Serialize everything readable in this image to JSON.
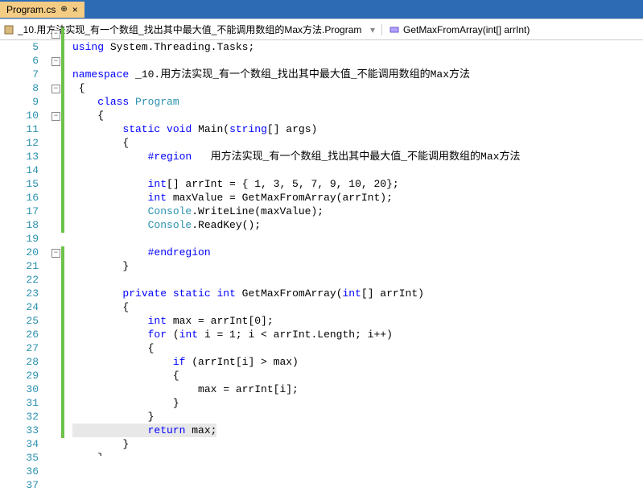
{
  "tab": {
    "title": "Program.cs",
    "pin": "⊕",
    "close": "×"
  },
  "nav": {
    "left_icon": "⚡",
    "scope": "_10.用方法实现_有一个数组_找出其中最大值_不能调用数组的Max方法.Program",
    "right_icon": "⚙",
    "method": "GetMaxFromArray(int[] arrInt)",
    "arrow": "▾"
  },
  "lines": [
    {
      "n": "5",
      "outline": "[",
      "code": [
        "kw:using",
        " System.Threading.Tasks;"
      ]
    },
    {
      "n": "6",
      "code": []
    },
    {
      "n": "7",
      "outline": "-",
      "green": 1,
      "code": [
        "kw:namespace",
        " _10.用方法实现_有一个数组_找出其中最大值_不能调用数组的Max方法"
      ]
    },
    {
      "n": "8",
      "green": 1,
      "code": [
        " {"
      ]
    },
    {
      "n": "9",
      "outline": "-",
      "green": 1,
      "code": [
        "    ",
        "kw:class",
        " ",
        "type:Program"
      ]
    },
    {
      "n": "10",
      "green": 1,
      "code": [
        "    {"
      ]
    },
    {
      "n": "11",
      "outline": "-",
      "green": 1,
      "code": [
        "        ",
        "kw:static",
        " ",
        "kw:void",
        " Main(",
        "kw:string",
        "[] args)"
      ]
    },
    {
      "n": "12",
      "green": 1,
      "code": [
        "        {"
      ]
    },
    {
      "n": "13",
      "outline": "-",
      "green": 1,
      "code": [
        "            ",
        "kw:#region",
        "   用方法实现_有一个数组_找出其中最大值_不能调用数组的Max方法"
      ]
    },
    {
      "n": "14",
      "green": 1,
      "code": []
    },
    {
      "n": "15",
      "green": 1,
      "code": [
        "            ",
        "kw:int",
        "[] arrInt = { 1, 3, 5, 7, 9, 10, 20};"
      ]
    },
    {
      "n": "16",
      "green": 1,
      "code": [
        "            ",
        "kw:int",
        " maxValue = GetMaxFromArray(arrInt);"
      ]
    },
    {
      "n": "17",
      "green": 1,
      "code": [
        "            ",
        "type:Console",
        ".WriteLine(maxValue);"
      ]
    },
    {
      "n": "18",
      "green": 1,
      "code": [
        "            ",
        "type:Console",
        ".ReadKey();"
      ]
    },
    {
      "n": "19",
      "green": 1,
      "code": []
    },
    {
      "n": "20",
      "green": 1,
      "code": [
        "            ",
        "kw:#endregion"
      ]
    },
    {
      "n": "21",
      "green": 1,
      "code": [
        "        }"
      ]
    },
    {
      "n": "22",
      "code": []
    },
    {
      "n": "23",
      "outline": "-",
      "green": 1,
      "code": [
        "        ",
        "kw:private",
        " ",
        "kw:static",
        " ",
        "kw:int",
        " GetMaxFromArray(",
        "kw:int",
        "[] arrInt)"
      ]
    },
    {
      "n": "24",
      "green": 1,
      "code": [
        "        {"
      ]
    },
    {
      "n": "25",
      "green": 1,
      "code": [
        "            ",
        "kw:int",
        " max = arrInt[0];"
      ]
    },
    {
      "n": "26",
      "green": 1,
      "code": [
        "            ",
        "kw:for",
        " (",
        "kw:int",
        " i = 1; i < arrInt.Length; i++)"
      ]
    },
    {
      "n": "27",
      "green": 1,
      "code": [
        "            {"
      ]
    },
    {
      "n": "28",
      "green": 1,
      "code": [
        "                ",
        "kw:if",
        " (arrInt[i] > max)"
      ]
    },
    {
      "n": "29",
      "green": 1,
      "code": [
        "                {"
      ]
    },
    {
      "n": "30",
      "green": 1,
      "code": [
        "                    max = arrInt[i];"
      ]
    },
    {
      "n": "31",
      "green": 1,
      "code": [
        "                }"
      ]
    },
    {
      "n": "32",
      "green": 1,
      "code": [
        "            }"
      ]
    },
    {
      "n": "33",
      "green": 1,
      "hl": 1,
      "code": [
        "            ",
        "kw:return",
        " max;"
      ]
    },
    {
      "n": "34",
      "green": 1,
      "code": [
        "        }"
      ]
    },
    {
      "n": "35",
      "green": 1,
      "code": [
        "    }"
      ]
    },
    {
      "n": "36",
      "green": 1,
      "code": [
        " }"
      ]
    },
    {
      "n": "37",
      "code": []
    }
  ]
}
